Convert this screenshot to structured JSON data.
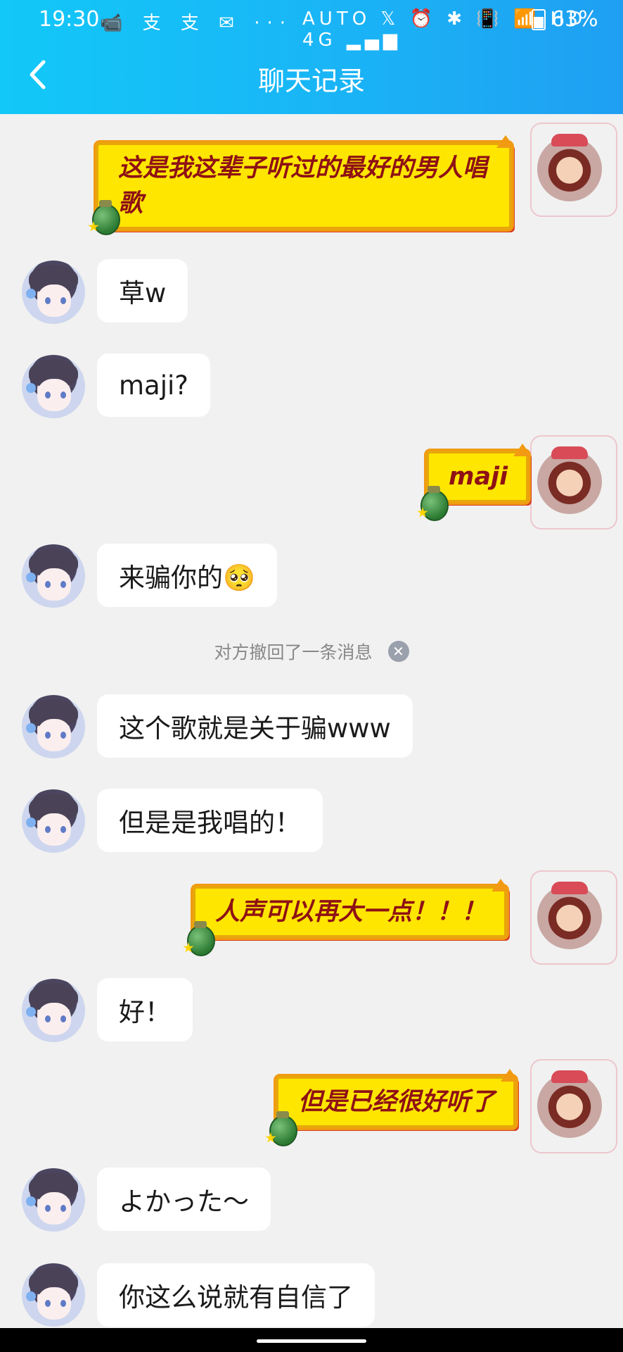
{
  "status_bar": {
    "time": "19:30",
    "left_icons": "📹 支 支 ✉ ···",
    "right_icons": "AUTO 𝕏 ⏰ ✱ 📳 📶 HD 4G ▂▄▆",
    "battery": "63%"
  },
  "header": {
    "back_icon": "chevron-left-icon",
    "title": "聊天记录"
  },
  "messages": [
    {
      "side": "right",
      "style": "yellow",
      "text": "这是我这辈子听过的最好的男人唱歌"
    },
    {
      "side": "left",
      "text": "草w"
    },
    {
      "side": "left",
      "text": "maji?"
    },
    {
      "side": "right",
      "style": "yellow",
      "text": "maji"
    },
    {
      "side": "left",
      "text": "来骗你的🥺"
    },
    {
      "side": "system",
      "text": "对方撤回了一条消息"
    },
    {
      "side": "left",
      "text": "这个歌就是关于骗www"
    },
    {
      "side": "left",
      "text": "但是是我唱的！"
    },
    {
      "side": "right",
      "style": "yellow",
      "text": "人声可以再大一点！！！"
    },
    {
      "side": "left",
      "text": "好！"
    },
    {
      "side": "right",
      "style": "yellow",
      "text": "但是已经很好听了"
    },
    {
      "side": "left",
      "text": "よかった〜"
    },
    {
      "side": "left",
      "text": "你这么说就有自信了"
    }
  ],
  "colors": {
    "header_gradient_start": "#12c8f8",
    "header_gradient_end": "#1f9ff2",
    "yellow_bubble": "#ffe600",
    "yellow_text": "#8e1115",
    "chat_background": "#f1f1f1"
  }
}
